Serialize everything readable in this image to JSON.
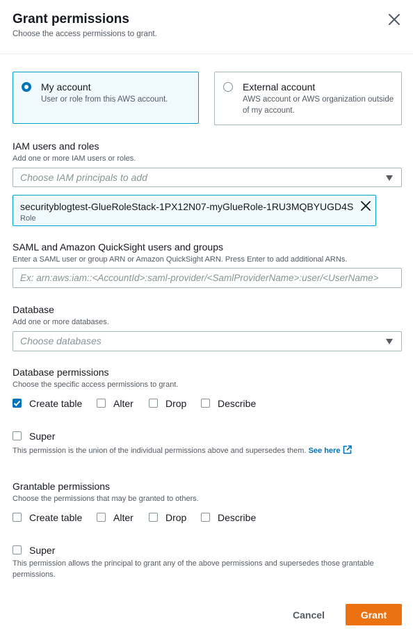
{
  "header": {
    "title": "Grant permissions",
    "subtitle": "Choose the access permissions to grant."
  },
  "account_options": [
    {
      "title": "My account",
      "description": "User or role from this AWS account.",
      "selected": true
    },
    {
      "title": "External account",
      "description": "AWS account or AWS organization outside of my account.",
      "selected": false
    }
  ],
  "iam": {
    "label": "IAM users and roles",
    "description": "Add one or more IAM users or roles.",
    "placeholder": "Choose IAM principals to add",
    "selected_token": {
      "name": "securityblogtest-GlueRoleStack-1PX12N07-myGlueRole-1RU3MQBYUGD4S",
      "type": "Role"
    }
  },
  "saml": {
    "label": "SAML and Amazon QuickSight users and groups",
    "description": "Enter a SAML user or group ARN or Amazon QuickSight ARN. Press Enter to add additional ARNs.",
    "placeholder": "Ex: arn:aws:iam::<AccountId>:saml-provider/<SamlProviderName>:user/<UserName>"
  },
  "database": {
    "label": "Database",
    "description": "Add one or more databases.",
    "placeholder": "Choose databases"
  },
  "database_permissions": {
    "label": "Database permissions",
    "description": "Choose the specific access permissions to grant.",
    "options": [
      {
        "label": "Create table",
        "checked": true
      },
      {
        "label": "Alter",
        "checked": false
      },
      {
        "label": "Drop",
        "checked": false
      },
      {
        "label": "Describe",
        "checked": false
      }
    ],
    "super": {
      "label": "Super",
      "checked": false
    },
    "note": "This permission is the union of the individual permissions above and supersedes them.",
    "link_text": "See here"
  },
  "grantable_permissions": {
    "label": "Grantable permissions",
    "description": "Choose the permissions that may be granted to others.",
    "options": [
      {
        "label": "Create table",
        "checked": false
      },
      {
        "label": "Alter",
        "checked": false
      },
      {
        "label": "Drop",
        "checked": false
      },
      {
        "label": "Describe",
        "checked": false
      }
    ],
    "super": {
      "label": "Super",
      "checked": false
    },
    "note": "This permission allows the principal to grant any of the above permissions and supersedes those grantable permissions."
  },
  "footer": {
    "cancel_label": "Cancel",
    "grant_label": "Grant"
  },
  "colors": {
    "accent_blue": "#0073bb",
    "selected_border": "#00a1c9",
    "primary_orange": "#ec7211"
  }
}
